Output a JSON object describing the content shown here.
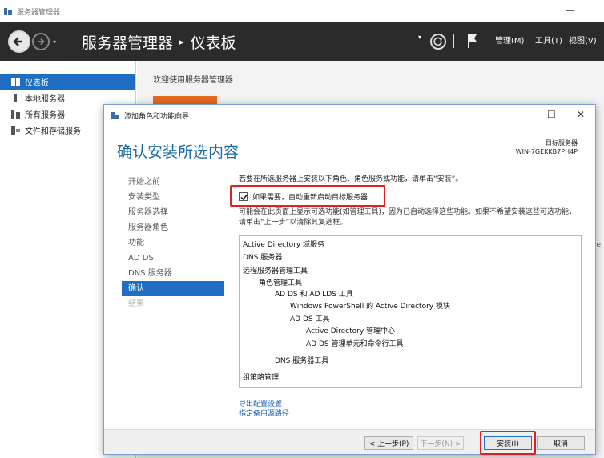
{
  "server_manager": {
    "window_title": "服务器管理器",
    "breadcrumb": [
      "服务器管理器",
      "仪表板"
    ],
    "menus": [
      "管理(M)",
      "工具(T)",
      "视图(V)"
    ],
    "sidebar": [
      {
        "label": "仪表板",
        "active": true
      },
      {
        "label": "本地服务器",
        "active": false
      },
      {
        "label": "所有服务器",
        "active": false
      },
      {
        "label": "文件和存储服务",
        "active": false
      }
    ],
    "welcome": "欢迎使用服务器管理器",
    "background_stub": "e"
  },
  "wizard": {
    "title": "添加角色和功能向导",
    "heading": "确认安装所选内容",
    "target_label": "目标服务器",
    "target_name": "WIN-7GEKKB7PH4P",
    "steps": [
      {
        "label": "开始之前",
        "state": "normal"
      },
      {
        "label": "安装类型",
        "state": "normal"
      },
      {
        "label": "服务器选择",
        "state": "normal"
      },
      {
        "label": "服务器角色",
        "state": "normal"
      },
      {
        "label": "功能",
        "state": "normal"
      },
      {
        "label": "AD DS",
        "state": "normal"
      },
      {
        "label": "DNS 服务器",
        "state": "normal"
      },
      {
        "label": "确认",
        "state": "current"
      },
      {
        "label": "结果",
        "state": "disabled"
      }
    ],
    "description": "若要在所选服务器上安装以下角色、角色服务或功能，请单击“安装”。",
    "restart_label": "如果需要，自动重新启动目标服务器",
    "restart_checked": true,
    "note": "可能会在此页面上显示可选功能(如管理工具)，因为已自动选择这些功能。如果不希望安装这些可选功能，请单击“上一步”以清除其复选框。",
    "features": [
      {
        "label": "Active Directory 域服务",
        "level": 0
      },
      {
        "label": "DNS 服务器",
        "level": 0
      },
      {
        "label": "远程服务器管理工具",
        "level": 0
      },
      {
        "label": "角色管理工具",
        "level": 1
      },
      {
        "label": "AD DS 和 AD LDS 工具",
        "level": 2
      },
      {
        "label": "Windows PowerShell 的 Active Directory 模块",
        "level": 3
      },
      {
        "label": "AD DS 工具",
        "level": 3
      },
      {
        "label": "Active Directory 管理中心",
        "level": 4
      },
      {
        "label": "AD DS 管理单元和命令行工具",
        "level": 4
      },
      {
        "label": "DNS 服务器工具",
        "level": 2
      },
      {
        "label": "组策略管理",
        "level": 0
      }
    ],
    "links": [
      "导出配置设置",
      "指定备用源路径"
    ],
    "buttons": {
      "prev": "< 上一步(P)",
      "next": "下一步(N) >",
      "install": "安装(I)",
      "cancel": "取消"
    }
  },
  "colors": {
    "accent": "#1e6fc4",
    "heading": "#1a6aa8",
    "highlight_border": "#e02020",
    "toolbar": "#2b2b2b",
    "tile": "#e86a1c"
  }
}
